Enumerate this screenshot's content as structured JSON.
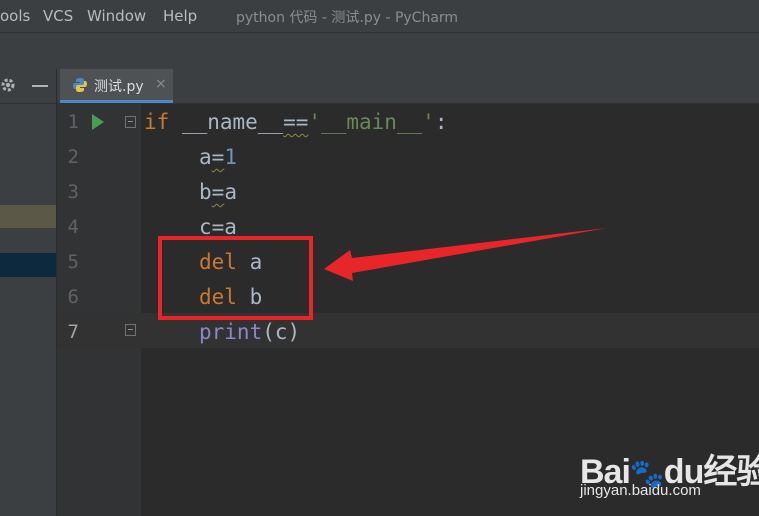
{
  "menubar": {
    "items": [
      {
        "label": "ools",
        "ul_char": ""
      },
      {
        "label": "VCS",
        "ul_char": ""
      },
      {
        "label": "Window",
        "ul_char": ""
      },
      {
        "label": "Help",
        "ul_char": ""
      }
    ],
    "window_title": "python 代码 - 测试.py - PyCharm"
  },
  "tab": {
    "label": "测试.py",
    "close": "×"
  },
  "icons": {
    "settings": "gear-icon",
    "minimize": "minus-icon",
    "python_file": "python-file-icon",
    "run": "run-triangle-icon",
    "fold": "fold-marker-icon"
  },
  "editor": {
    "lines": [
      {
        "num": "1"
      },
      {
        "num": "2"
      },
      {
        "num": "3"
      },
      {
        "num": "4"
      },
      {
        "num": "5"
      },
      {
        "num": "6"
      },
      {
        "num": "7"
      }
    ],
    "code": {
      "l1_kw": "if",
      "l1_mid": " __name__",
      "l1_op": "==",
      "l1_str": "'__main__'",
      "l1_colon": ":",
      "l2_var": "a",
      "l2_op": "=",
      "l2_num": "1",
      "l3_var": "b",
      "l3_op": "=",
      "l3_rhs": "a",
      "l4_text": "c=a",
      "l5_kw": "del",
      "l5_var": " a",
      "l6_kw": "del",
      "l6_var": " b",
      "l7_fn": "print",
      "l7_args": "(c)"
    }
  },
  "watermark": {
    "main": "Bai",
    "paw": "🐾",
    "du": "du",
    "cn": "经验",
    "sub": "jingyan.baidu.com"
  },
  "colors": {
    "annotation_red": "#e8262a",
    "keyword": "#cc7832",
    "string": "#6a8759",
    "number": "#6897bb"
  }
}
